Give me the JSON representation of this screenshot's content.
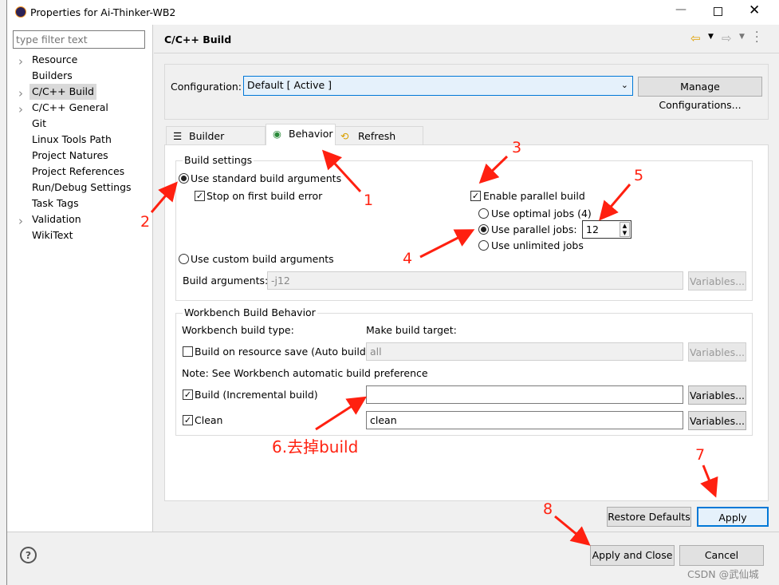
{
  "window": {
    "title": "Properties for Ai-Thinker-WB2"
  },
  "sidebar": {
    "filter_placeholder": "type filter text",
    "items": [
      {
        "label": "Resource",
        "expandable": true
      },
      {
        "label": "Builders",
        "expandable": false
      },
      {
        "label": "C/C++ Build",
        "expandable": true,
        "selected": true
      },
      {
        "label": "C/C++ General",
        "expandable": true
      },
      {
        "label": "Git",
        "expandable": false
      },
      {
        "label": "Linux Tools Path",
        "expandable": false
      },
      {
        "label": "Project Natures",
        "expandable": false
      },
      {
        "label": "Project References",
        "expandable": false
      },
      {
        "label": "Run/Debug Settings",
        "expandable": false
      },
      {
        "label": "Task Tags",
        "expandable": false
      },
      {
        "label": "Validation",
        "expandable": true
      },
      {
        "label": "WikiText",
        "expandable": false
      }
    ]
  },
  "page": {
    "title": "C/C++ Build"
  },
  "config": {
    "label": "Configuration:",
    "value": "Default  [ Active ]",
    "manage_label": "Manage Configurations..."
  },
  "tabs": [
    {
      "label": "Builder Settings"
    },
    {
      "label": "Behavior",
      "active": true
    },
    {
      "label": "Refresh Policy"
    }
  ],
  "build_settings": {
    "title": "Build settings",
    "use_standard": "Use standard build arguments",
    "stop_on_error": "Stop on first build error",
    "enable_parallel": "Enable parallel build",
    "optimal_jobs": "Use optimal jobs (4)",
    "parallel_jobs": "Use parallel jobs:",
    "parallel_jobs_value": "12",
    "unlimited_jobs": "Use unlimited jobs",
    "use_custom": "Use custom build arguments",
    "build_args_label": "Build arguments:",
    "build_args_value": "-j12",
    "variables": "Variables..."
  },
  "workbench": {
    "title": "Workbench Build Behavior",
    "type_label": "Workbench build type:",
    "target_label": "Make build target:",
    "auto_build": "Build on resource save (Auto build)",
    "auto_build_value": "all",
    "note": "Note: See Workbench automatic build preference",
    "incremental": "Build (Incremental build)",
    "incremental_value": "",
    "clean": "Clean",
    "clean_value": "clean",
    "variables": "Variables..."
  },
  "buttons": {
    "restore": "Restore Defaults",
    "apply": "Apply",
    "apply_close": "Apply and Close",
    "cancel": "Cancel"
  },
  "annotations": {
    "a1": "1",
    "a2": "2",
    "a3": "3",
    "a4": "4",
    "a5": "5",
    "a6": "6.去掉build",
    "a7": "7",
    "a8": "8",
    "color": "#ff2010"
  },
  "watermark": "CSDN @武仙城"
}
